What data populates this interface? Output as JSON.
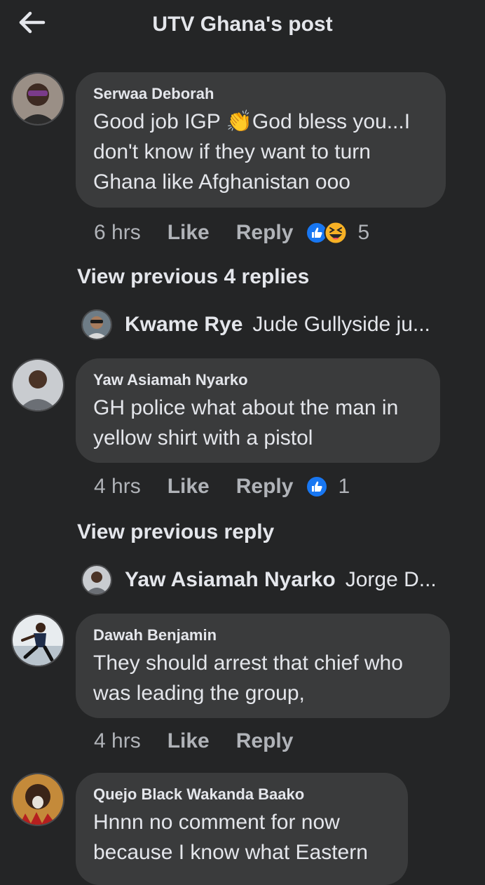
{
  "header": {
    "title": "UTV Ghana's post",
    "back_icon": "back-arrow-icon"
  },
  "comments": [
    {
      "author": "Serwaa Deborah",
      "lines": [
        "Good job IGP 👏God bless you...I",
        "don't know if they want to turn",
        "Ghana like Afghanistan ooo"
      ],
      "time": "6 hrs",
      "like": "Like",
      "reply": "Reply",
      "reactions": [
        "like-reaction-icon",
        "haha-reaction-icon"
      ],
      "reaction_count": "5"
    },
    {
      "author": "Yaw Asiamah Nyarko",
      "lines": [
        "GH police what about the man in",
        "yellow shirt with a pistol"
      ],
      "time": "4 hrs",
      "like": "Like",
      "reply": "Reply",
      "reactions": [
        "like-reaction-icon"
      ],
      "reaction_count": "1"
    },
    {
      "author": "Dawah Benjamin",
      "lines": [
        "They should arrest that chief who",
        "was leading the group,"
      ],
      "time": "4 hrs",
      "like": "Like",
      "reply": "Reply"
    },
    {
      "author": "Quejo Black Wakanda Baako",
      "lines": [
        "Hnnn no comment for now",
        "because I know what Eastern"
      ]
    }
  ],
  "threads": [
    {
      "view_label": "View previous 4 replies",
      "reply_author": "Kwame Rye",
      "reply_text": "Jude Gullyside ju..."
    },
    {
      "view_label": "View previous reply",
      "reply_author": "Yaw Asiamah Nyarko",
      "reply_text": "Jorge D..."
    }
  ],
  "colors": {
    "background": "#242526",
    "bubble": "#3a3b3c",
    "text": "#e4e6eb",
    "muted": "#b0b3b8",
    "like_blue": "#1877f2"
  }
}
